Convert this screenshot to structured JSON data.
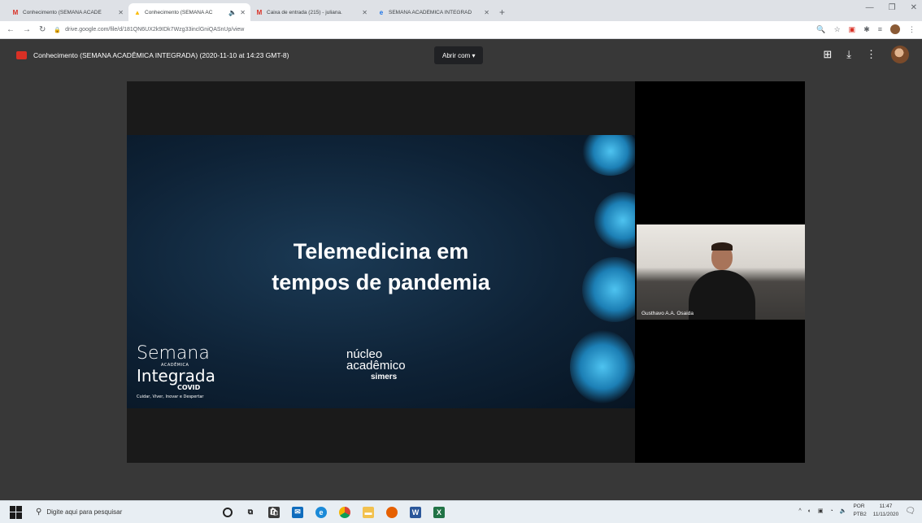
{
  "browser": {
    "tabs": [
      {
        "label": "Conhecimento (SEMANA ACADÊ",
        "icon": "gmail-icon",
        "active": false
      },
      {
        "label": "Conhecimento (SEMANA AC",
        "icon": "drive-icon",
        "active": true
      },
      {
        "label": "Caixa de entrada (215) - juliana.",
        "icon": "gmail-icon",
        "active": false
      },
      {
        "label": "SEMANA ACADÊMICA INTEGRAD",
        "icon": "event-icon",
        "active": false
      }
    ],
    "new_tab": "+",
    "url": "drive.google.com/file/d/181QN6UX2k9IDk7Wzg33inclGniQASnUp/view"
  },
  "viewer": {
    "title": "Conhecimento (SEMANA ACADÊMICA INTEGRADA) (2020-11-10 at 14:23 GMT-8)",
    "open_with": "Abrir com ▾"
  },
  "slide": {
    "title_line1": "Telemedicina em",
    "title_line2": "tempos de pandemia",
    "logo_semana": {
      "l1": "Semana",
      "l2": "ACADÊMICA",
      "l3": "Integrada",
      "l4": "COVID",
      "l5": "Cuidar, Viver, Inovar e Despertar"
    },
    "logo_nucleo": {
      "l1": "núcleo",
      "l2": "acadêmico",
      "l3": "simers"
    }
  },
  "camera": {
    "name": "Gusthavo A.A. Osaida"
  },
  "taskbar": {
    "search_placeholder": "Digite aqui para pesquisar",
    "lang_line1": "POR",
    "lang_line2": "PTB2",
    "time": "11:47",
    "date": "11/11/2020"
  },
  "colors": {
    "viewer_bg": "#383838",
    "gmail_red": "#d93025",
    "drive_yellow": "#fbbc04",
    "accent_blue": "#4ec3f0"
  }
}
